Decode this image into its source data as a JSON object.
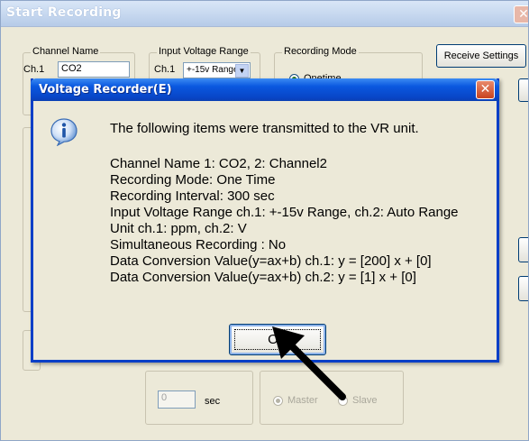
{
  "main_window": {
    "title": "Start Recording",
    "close_glyph": "✕",
    "channel_name": {
      "legend": "Channel Name",
      "ch1_label": "Ch.1",
      "ch1_value": "CO2"
    },
    "input_voltage_range": {
      "legend": "Input Voltage Range",
      "ch1_label": "Ch.1",
      "ch1_value": "+-15v Range",
      "arrow": "▼"
    },
    "recording_mode": {
      "legend": "Recording Mode",
      "option_onetime": "Onetime"
    },
    "receive_settings_button": "Receive Settings",
    "interval": {
      "value": "0",
      "unit": "sec"
    },
    "sync": {
      "master": "Master",
      "slave": "Slave"
    }
  },
  "dialog": {
    "title": "Voltage Recorder(E)",
    "close_glyph": "✕",
    "icon": "info-icon",
    "message": "The following items were transmitted to the VR unit.",
    "lines": [
      "Channel Name 1: CO2, 2: Channel2",
      "Recording Mode: One Time",
      "Recording Interval: 300 sec",
      "Input Voltage Range ch.1: +-15v Range, ch.2:  Auto Range",
      "Unit ch.1: ppm, ch.2: V",
      "Simultaneous Recording : No",
      "Data Conversion Value(y=ax+b) ch.1: y = [200] x + [0]",
      "Data Conversion Value(y=ax+b) ch.2: y = [1] x + [0]"
    ],
    "ok_label": "OK"
  },
  "colors": {
    "dialog_titlebar": "#0a58e0",
    "window_face": "#ece9d8",
    "annotation_arrow": "#000000"
  }
}
